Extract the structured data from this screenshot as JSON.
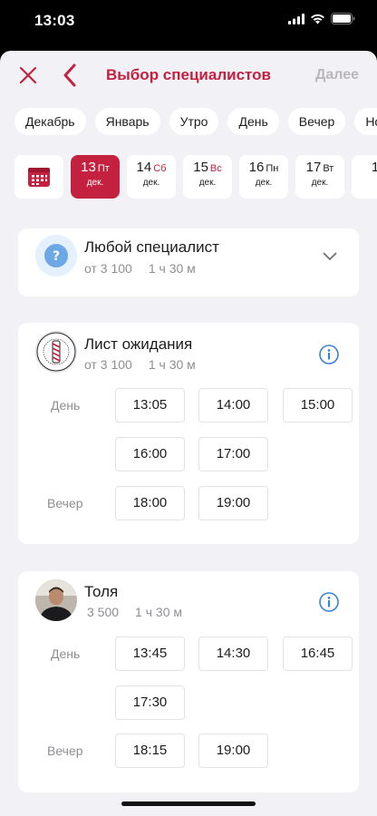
{
  "status": {
    "time": "13:03"
  },
  "nav": {
    "title": "Выбор специалистов",
    "next_label": "Далее"
  },
  "filters": [
    "Декабрь",
    "Январь",
    "Утро",
    "День",
    "Вечер",
    "Но"
  ],
  "dates": [
    {
      "day": "13",
      "dow": "Пт",
      "month": "дек.",
      "selected": true,
      "weekend": false
    },
    {
      "day": "14",
      "dow": "Сб",
      "month": "дек.",
      "selected": false,
      "weekend": true
    },
    {
      "day": "15",
      "dow": "Вс",
      "month": "дек.",
      "selected": false,
      "weekend": true
    },
    {
      "day": "16",
      "dow": "Пн",
      "month": "дек.",
      "selected": false,
      "weekend": false
    },
    {
      "day": "17",
      "dow": "Вт",
      "month": "дек.",
      "selected": false,
      "weekend": false
    },
    {
      "day": "1",
      "dow": "",
      "month": "",
      "selected": false,
      "weekend": false
    }
  ],
  "any_specialist": {
    "name": "Любой специалист",
    "price": "от 3 100",
    "duration": "1 ч 30 м"
  },
  "waitlist": {
    "name": "Лист ожидания",
    "price": "от 3 100",
    "duration": "1 ч 30 м",
    "day_label": "День",
    "evening_label": "Вечер",
    "day_slots": [
      "13:05",
      "14:00",
      "15:00",
      "16:00",
      "17:00"
    ],
    "evening_slots": [
      "18:00",
      "19:00"
    ]
  },
  "tolya": {
    "name": "Толя",
    "price": "3 500",
    "duration": "1 ч 30 м",
    "day_label": "День",
    "evening_label": "Вечер",
    "day_slots": [
      "13:45",
      "14:30",
      "16:45",
      "17:30"
    ],
    "evening_slots": [
      "18:15",
      "19:00"
    ]
  },
  "colors": {
    "accent": "#c4203f",
    "info": "#3b82d6",
    "sheet_bg": "#f2f1f6"
  }
}
